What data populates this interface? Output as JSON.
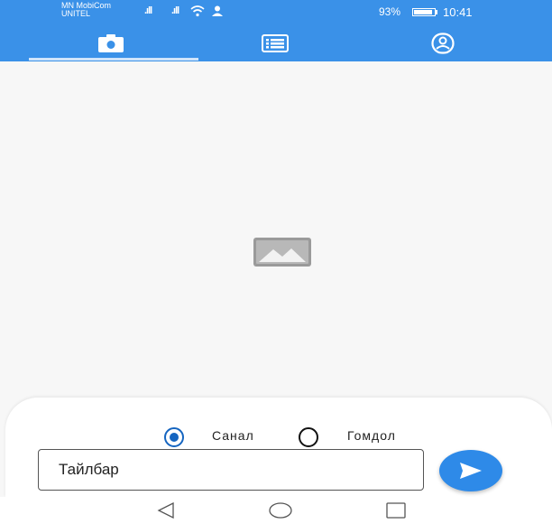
{
  "status_bar": {
    "carrier_1": "MN MobiCom",
    "carrier_2": "UNITEL",
    "signal_1": ".ıll",
    "signal_2": ".ıll",
    "battery_percent": "93%",
    "battery_level": 0.93,
    "time": "10:41"
  },
  "tabs": [
    {
      "icon": "camera-icon",
      "selected": true
    },
    {
      "icon": "list-icon",
      "selected": false
    },
    {
      "icon": "profile-icon",
      "selected": false
    }
  ],
  "feedback_type": {
    "options": [
      {
        "label": "Санал",
        "selected": true
      },
      {
        "label": "Гомдол",
        "selected": false
      }
    ]
  },
  "description": {
    "placeholder": "Тайлбар"
  },
  "colors": {
    "primary": "#3a91e8",
    "radio_selected": "#1565c0",
    "send_button": "#2e8ae8"
  }
}
